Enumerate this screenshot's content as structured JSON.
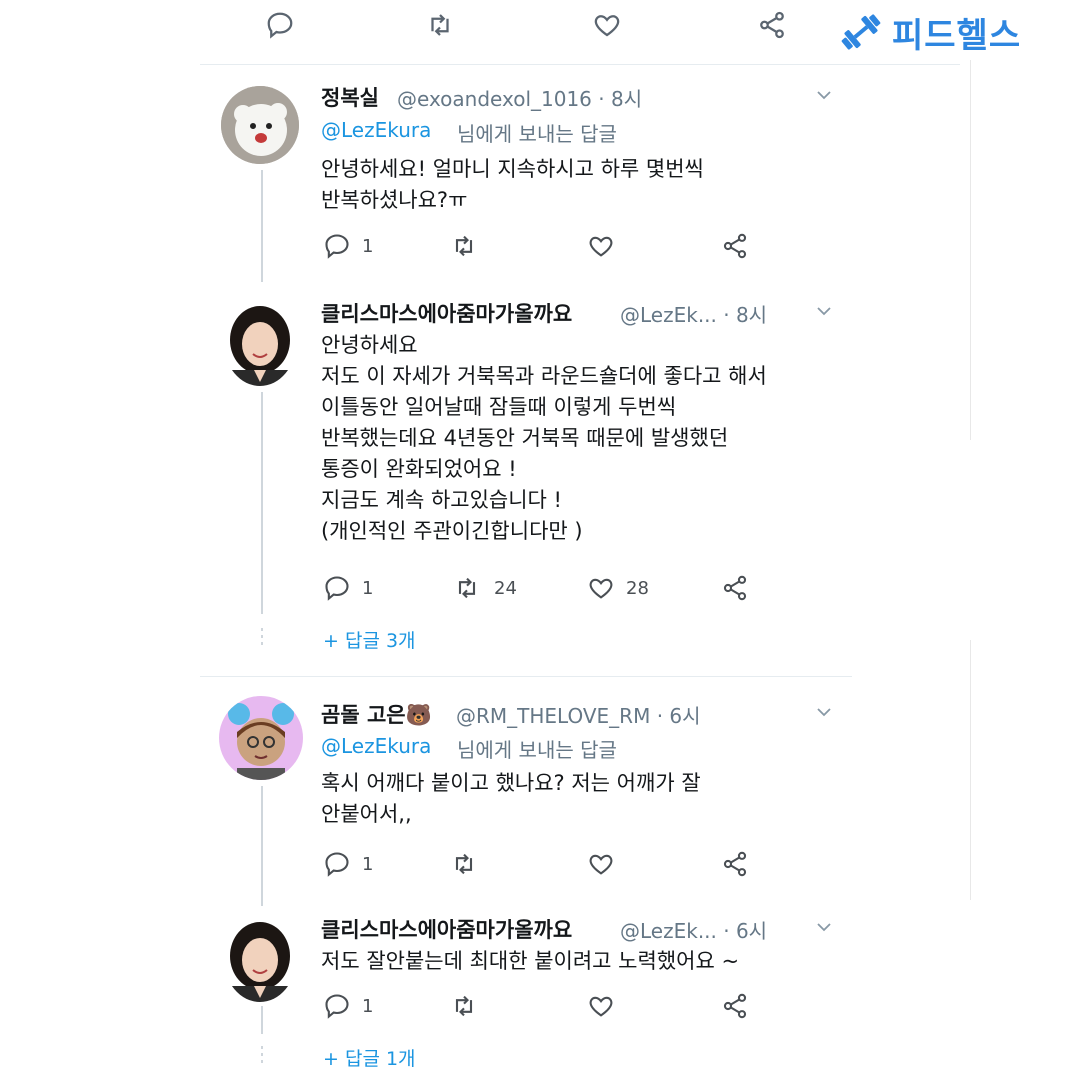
{
  "brand": {
    "name": "피드헬스",
    "color": "#2e86e0"
  },
  "colors": {
    "link": "#1b95e0",
    "muted": "#657786",
    "text": "#14171a"
  },
  "tweets": [
    {
      "name": "정복실",
      "handle": "@exoandexol_1016 · 8시",
      "mention": "@LezEkura",
      "replying_suffix": "님에게 보내는 답글",
      "text": "안녕하세요! 얼마니 지속하시고 하루 몇번씩\n반복하셨나요?ㅠ",
      "reply_count": "1",
      "retweet_count": "",
      "like_count": ""
    },
    {
      "name": "클리스마스에아줌마가올까요",
      "handle": "@LezEk... · 8시",
      "text": "안녕하세요\n저도 이 자세가 거북목과 라운드숄더에 좋다고 해서\n이틀동안 일어날때 잠들때 이렇게 두번씩\n반복했는데요 4년동안 거북목 때문에 발생했던\n통증이 완화되었어요 !\n지금도 계속 하고있습니다 !\n(개인적인 주관이긴합니다만 )",
      "reply_count": "1",
      "retweet_count": "24",
      "like_count": "28",
      "more_replies": "+ 답글 3개"
    },
    {
      "name": "곰돌 고은",
      "emoji": "🐻",
      "handle": "@RM_THELOVE_RM · 6시",
      "mention": "@LezEkura",
      "replying_suffix": "님에게 보내는 답글",
      "text": "혹시 어깨다 붙이고 했나요? 저는 어깨가 잘\n안붙어서,,",
      "reply_count": "1",
      "retweet_count": "",
      "like_count": ""
    },
    {
      "name": "클리스마스에아줌마가올까요",
      "handle": "@LezEk... · 6시",
      "text": "저도 잘안붙는데 최대한 붙이려고 노력했어요 ~",
      "reply_count": "1",
      "retweet_count": "",
      "like_count": "",
      "more_replies": "+ 답글 1개"
    }
  ]
}
